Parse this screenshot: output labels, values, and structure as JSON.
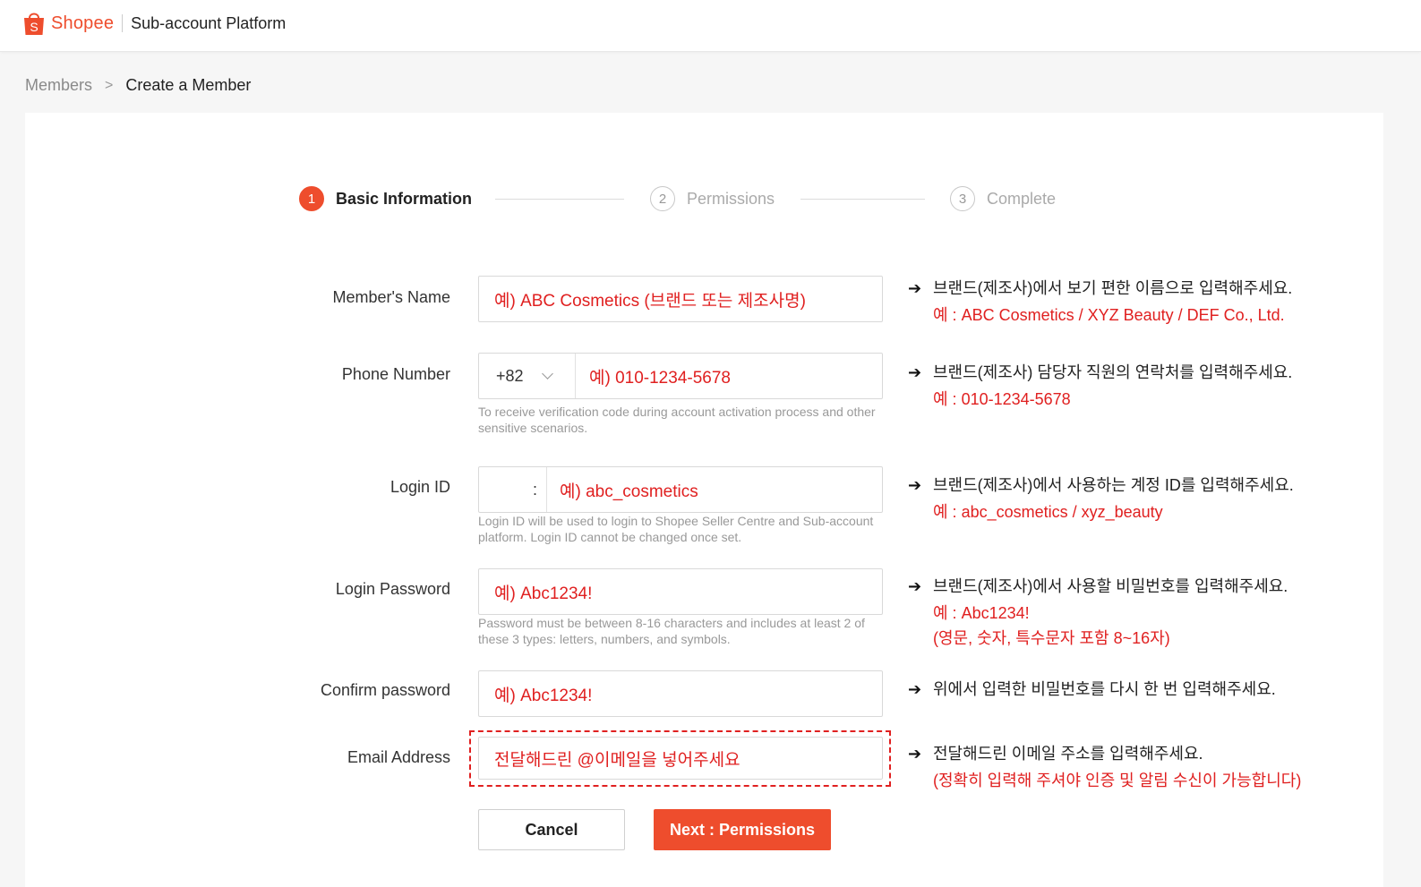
{
  "header": {
    "brand": "Shopee",
    "platform": "Sub-account Platform"
  },
  "breadcrumb": {
    "parent": "Members",
    "separator": ">",
    "current": "Create a Member"
  },
  "stepper": {
    "steps": [
      {
        "number": "1",
        "label": "Basic Information",
        "active": true
      },
      {
        "number": "2",
        "label": "Permissions",
        "active": false
      },
      {
        "number": "3",
        "label": "Complete",
        "active": false
      }
    ]
  },
  "form": {
    "member_name": {
      "label": "Member's Name",
      "placeholder": "예) ABC Cosmetics (브랜드 또는 제조사명)"
    },
    "phone": {
      "label": "Phone Number",
      "country_code": "+82",
      "placeholder": "예) 010-1234-5678",
      "hint": "To receive verification code during account activation process and other sensitive scenarios."
    },
    "login_id": {
      "label": "Login ID",
      "prefix": ":",
      "placeholder": "예) abc_cosmetics",
      "hint": "Login ID will be used to login to Shopee Seller Centre and Sub-account platform. Login ID cannot be changed once set."
    },
    "password": {
      "label": "Login Password",
      "placeholder": "예) Abc1234!",
      "hint": "Password must be between 8-16 characters and includes at least 2 of these 3 types: letters, numbers, and symbols."
    },
    "confirm_password": {
      "label": "Confirm password",
      "placeholder": "예) Abc1234!"
    },
    "email": {
      "label": "Email Address",
      "placeholder": "전달해드린 @이메일을 넣어주세요"
    }
  },
  "annotations": {
    "member_name": {
      "main": "브랜드(제조사)에서 보기 편한 이름으로 입력해주세요.",
      "examples": [
        "예 : ABC Cosmetics / XYZ Beauty / DEF Co., Ltd."
      ]
    },
    "phone": {
      "main": "브랜드(제조사) 담당자 직원의 연락처를 입력해주세요.",
      "examples": [
        "예 : 010-1234-5678"
      ]
    },
    "login_id": {
      "main": "브랜드(제조사)에서 사용하는 계정 ID를 입력해주세요.",
      "examples": [
        "예 : abc_cosmetics / xyz_beauty"
      ]
    },
    "password": {
      "main": "브랜드(제조사)에서 사용할 비밀번호를 입력해주세요.",
      "examples": [
        "예 : Abc1234!",
        "(영문, 숫자, 특수문자 포함 8~16자)"
      ]
    },
    "confirm_password": {
      "main": "위에서 입력한 비밀번호를 다시 한 번 입력해주세요.",
      "examples": []
    },
    "email": {
      "main": "전달해드린 이메일 주소를 입력해주세요.",
      "examples": [
        "(정확히 입력해 주셔야 인증 및 알림 수신이 가능합니다)"
      ]
    },
    "arrow": "➔"
  },
  "buttons": {
    "cancel": "Cancel",
    "next": "Next : Permissions"
  },
  "colors": {
    "brand": "#ee4d2d",
    "annotation_red": "#e02020"
  }
}
